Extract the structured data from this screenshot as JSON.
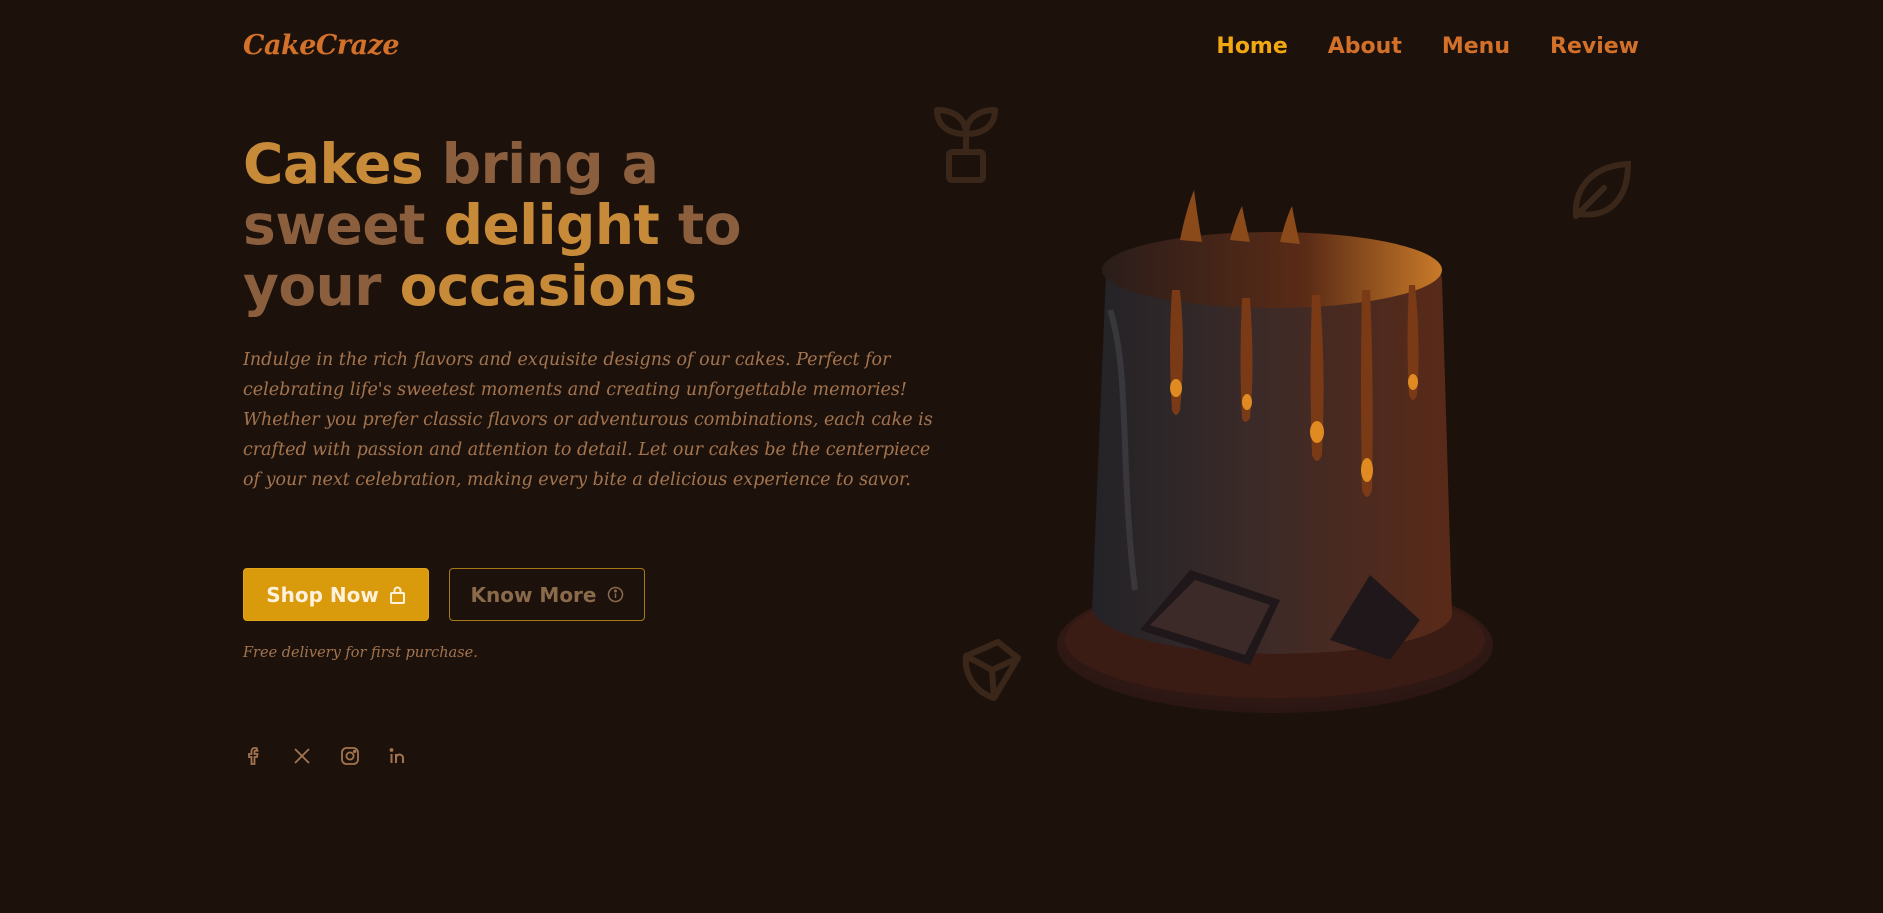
{
  "brand": {
    "logo": "CakeCraze"
  },
  "nav": {
    "items": [
      {
        "label": "Home",
        "active": true
      },
      {
        "label": "About",
        "active": false
      },
      {
        "label": "Menu",
        "active": false
      },
      {
        "label": "Review",
        "active": false
      }
    ]
  },
  "hero": {
    "headline": {
      "line1_a": "Cakes",
      "line1_b": " bring a",
      "line2_a": "sweet ",
      "line2_b": "delight",
      "line2_c": " to",
      "line3_a": "your ",
      "line3_b": "occasions"
    },
    "description": "Indulge in the rich flavors and exquisite designs of our cakes. Perfect for celebrating life's sweetest moments and creating unforgettable memories! Whether you prefer classic flavors or adventurous combinations, each cake is crafted with passion and attention to detail. Let our cakes be the centerpiece of your next celebration, making every bite a delicious experience to savor.",
    "primary_button": {
      "label": "Shop Now",
      "icon": "shopping-bag-icon"
    },
    "secondary_button": {
      "label": "Know More",
      "icon": "info-circle-icon"
    },
    "delivery_note": "Free delivery for first purchase."
  },
  "social": {
    "icons": [
      "facebook-icon",
      "x-twitter-icon",
      "instagram-icon",
      "linkedin-icon"
    ]
  },
  "decorations": [
    "sprout-icon",
    "leaf-icon",
    "seed-icon"
  ],
  "colors": {
    "background": "#1c120b",
    "brand_orange": "#d3702a",
    "active_yellow": "#f2a813",
    "headline_highlight": "#c78a38",
    "headline_muted": "#8b5f3e",
    "button_primary": "#d99a0b"
  }
}
